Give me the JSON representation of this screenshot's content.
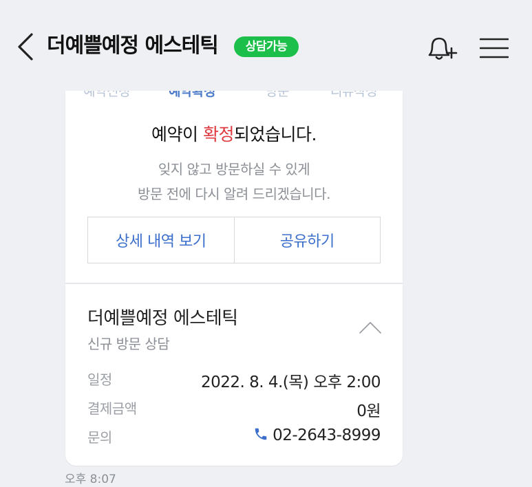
{
  "header": {
    "title": "더예쁠예정 에스테틱",
    "badge": "상담가능",
    "accent_color": "#1cbf4a",
    "icons": [
      "back-icon",
      "bell-plus-icon",
      "menu-icon"
    ]
  },
  "steps": [
    "예약신청",
    "예약확정",
    "방문",
    "리뷰작성"
  ],
  "active_step": "예약확정",
  "card": {
    "headline_prefix": "예약이 ",
    "headline_highlight": "확정",
    "headline_suffix": "되었습니다.",
    "subtext_line1": "잊지 않고 방문하실 수 있게",
    "subtext_line2": "방문 전에 다시 알려 드리겠습니다.",
    "btn_detail": "상세 내역 보기",
    "btn_share": "공유하기",
    "shop_name": "더예쁠예정 에스테틱",
    "service": "신규 방문 상담",
    "rows": [
      {
        "label": "일정",
        "value": "2022. 8. 4.(목) 오후 2:00"
      },
      {
        "label": "결제금액",
        "value": "0원"
      },
      {
        "label": "문의",
        "value": "02-2643-8999"
      }
    ]
  },
  "timestamp": "오후 8:07"
}
